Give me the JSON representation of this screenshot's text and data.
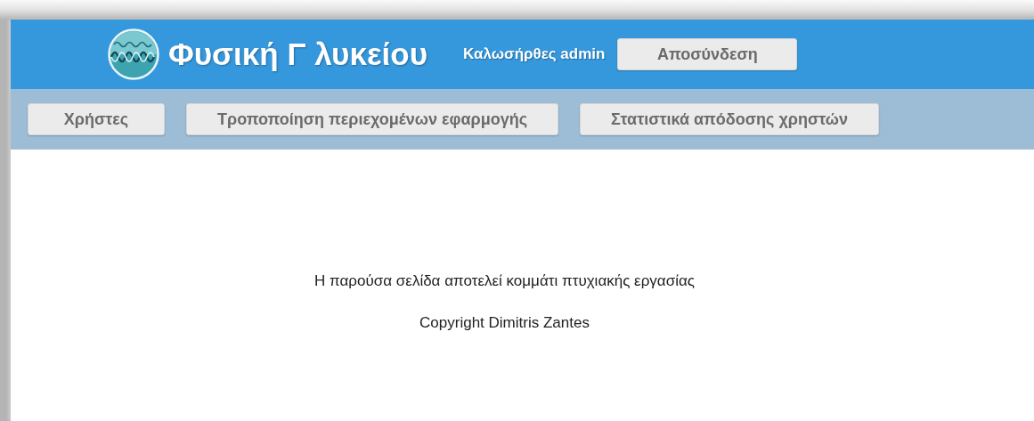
{
  "header": {
    "title": "Φυσική Γ λυκείου",
    "welcome": "Καλωσήρθες admin",
    "logout_button": "Αποσύνδεση"
  },
  "nav": [
    {
      "label": "Χρήστες"
    },
    {
      "label": "Τροποποίηση περιεχομένων εφαρμογής"
    },
    {
      "label": "Στατιστικά απόδοσης χρηστών"
    }
  ],
  "footer": {
    "note": "Η παρούσα σελίδα αποτελεί κομμάτι πτυχιακής εργασίας",
    "copyright": "Copyright Dimitris Zantes"
  }
}
